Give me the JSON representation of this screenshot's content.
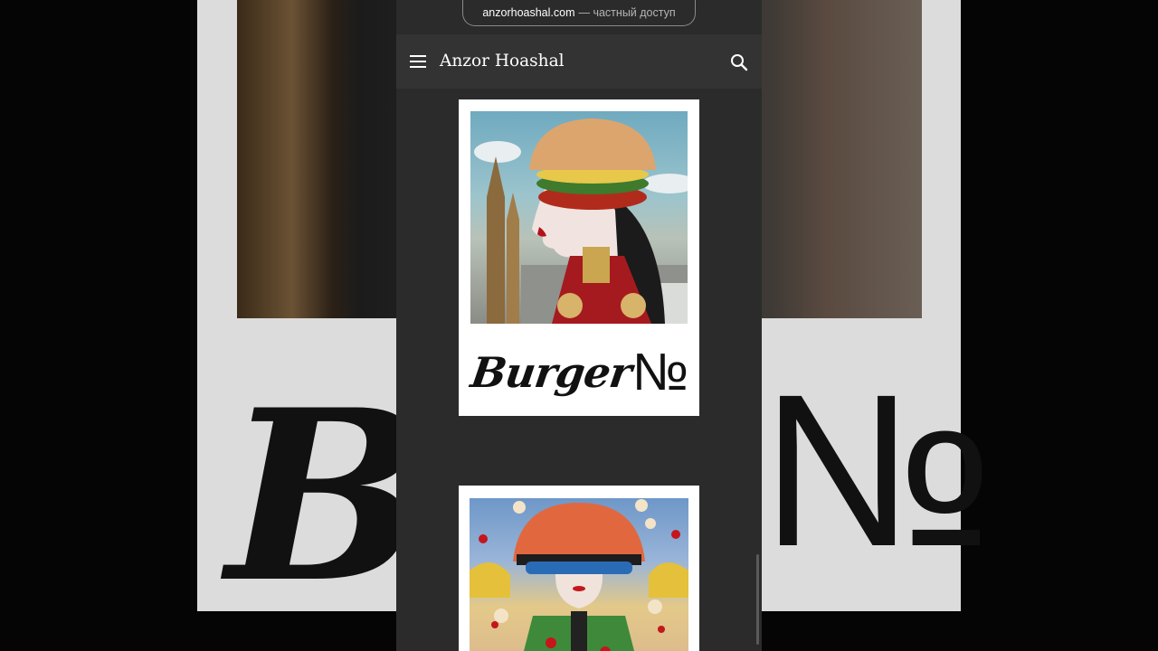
{
  "browser": {
    "url": "anzorhoashal.com",
    "access_label": "— частный доступ"
  },
  "header": {
    "menu_icon": "hamburger-menu-icon",
    "title": "Anzor Hoashal",
    "search_icon": "search-icon"
  },
  "posts": [
    {
      "image": "burger-headdress-woman-artwork",
      "logo_script": "Burger",
      "logo_numero": "№"
    },
    {
      "image": "burger-helmet-woman-artwork"
    }
  ],
  "background": {
    "logo_script": "B",
    "logo_numero": "№"
  }
}
